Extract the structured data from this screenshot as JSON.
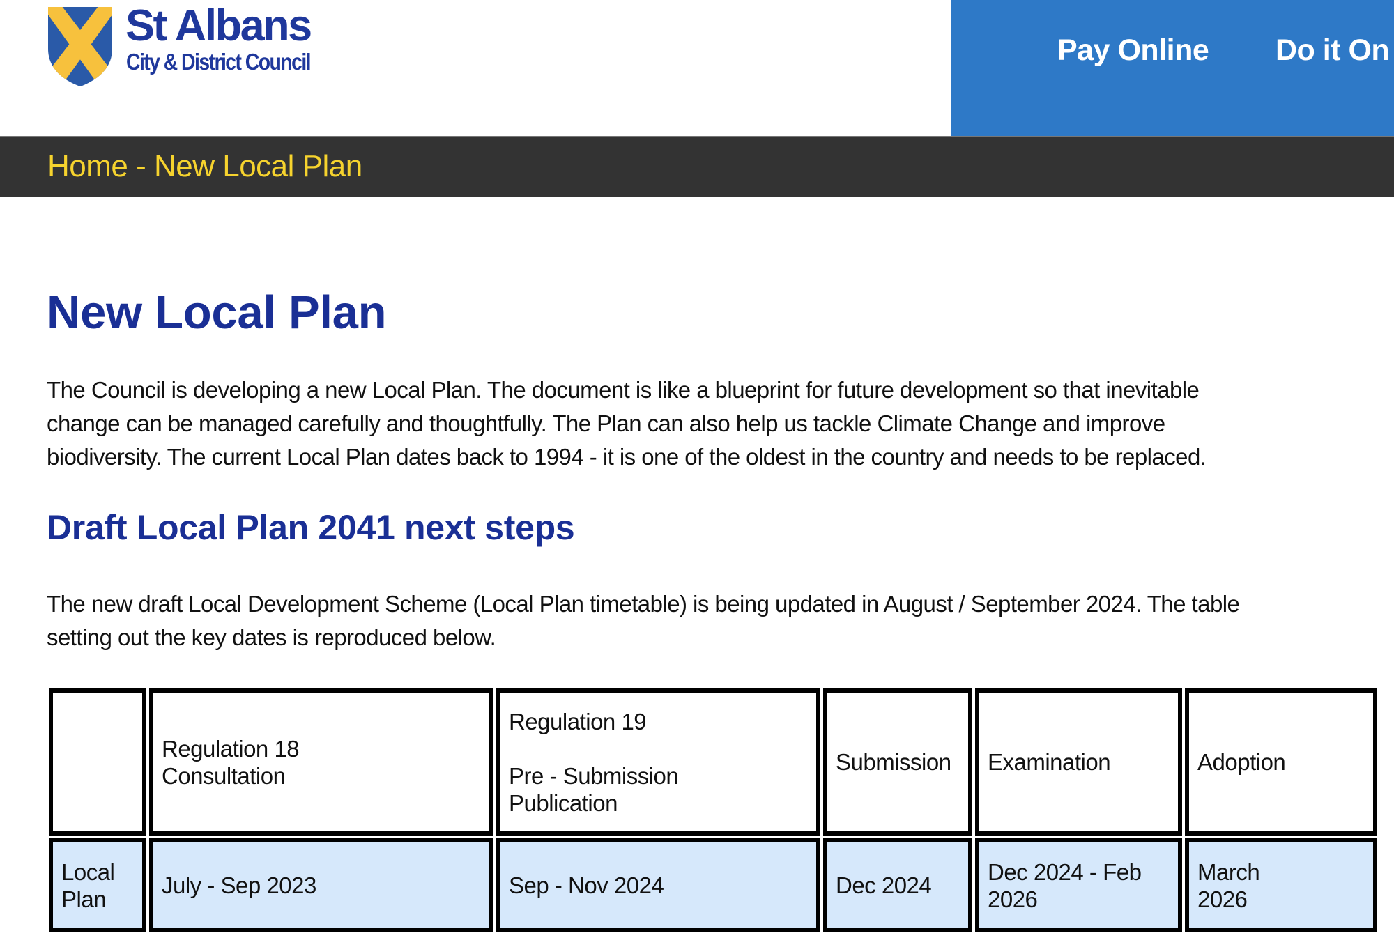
{
  "header": {
    "logo": {
      "name": "St Albans",
      "subtitle": "City & District Council",
      "colors": {
        "shield_blue": "#2a5aa8",
        "cross_yellow": "#f7c13d",
        "text_blue": "#1f389c"
      }
    },
    "nav": {
      "background": "#2e79c7",
      "items": [
        {
          "label": "Pay Online",
          "icon": null
        },
        {
          "label": "Do it On"
        }
      ]
    }
  },
  "breadcrumb": {
    "items": [
      "Home",
      "New Local Plan"
    ],
    "separator": " - ",
    "color": "#f6d32e"
  },
  "main": {
    "title": "New Local Plan",
    "intro_lines": [
      "The Council is developing a new Local Plan. The document is like a blueprint for future development so that inevitable",
      "change can be managed carefully and thoughtfully. The Plan can also help us tackle Climate Change and improve",
      "biodiversity. The current Local Plan dates back to 1994 - it is one of the oldest in the country and needs to be replaced."
    ],
    "subheading": "Draft Local Plan 2041 next steps",
    "lds_lines": [
      "The new draft Local Development Scheme (Local Plan timetable) is being updated in August / September 2024. The table",
      "setting out the key dates is reproduced below."
    ],
    "table": {
      "headers": [
        {
          "lines": [
            ""
          ]
        },
        {
          "lines": [
            "Regulation 18",
            "Consultation"
          ]
        },
        {
          "lines": [
            "Regulation 19",
            "",
            "Pre - Submission",
            "Publication"
          ]
        },
        {
          "lines": [
            "Submission"
          ]
        },
        {
          "lines": [
            "Examination"
          ]
        },
        {
          "lines": [
            "Adoption"
          ]
        }
      ],
      "rows": [
        {
          "cells": [
            {
              "lines": [
                "Local",
                "Plan"
              ]
            },
            {
              "lines": [
                "July - Sep 2023"
              ]
            },
            {
              "lines": [
                "Sep - Nov 2024"
              ]
            },
            {
              "lines": [
                "Dec 2024"
              ]
            },
            {
              "lines": [
                "Dec 2024 - Feb",
                "2026"
              ]
            },
            {
              "lines": [
                "March",
                "2026"
              ]
            }
          ]
        }
      ],
      "row_highlight_color": "#d6e8fb"
    }
  }
}
